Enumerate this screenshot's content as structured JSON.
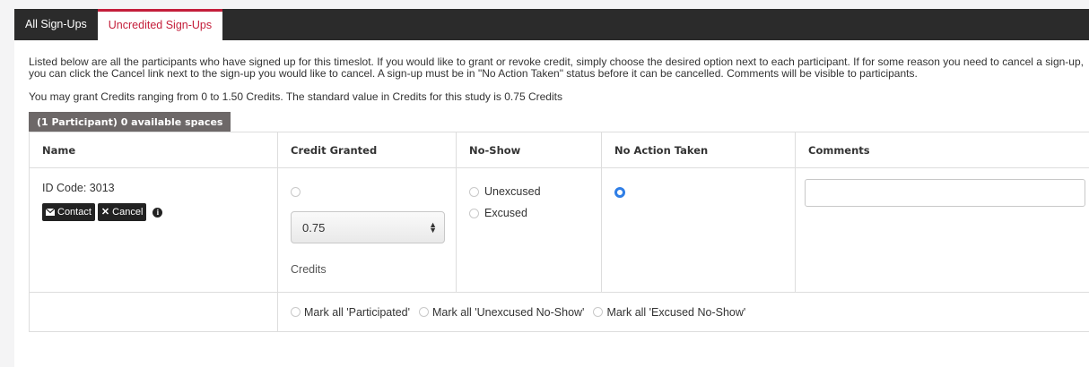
{
  "tabs": [
    {
      "label": "All Sign-Ups",
      "active": false
    },
    {
      "label": "Uncredited Sign-Ups",
      "active": true
    }
  ],
  "description": "Listed below are all the participants who have signed up for this timeslot. If you would like to grant or revoke credit, simply choose the desired option next to each participant. If for some reason you need to cancel a sign-up, you can click the Cancel link next to the sign-up you would like to cancel. A sign-up must be in \"No Action Taken\" status before it can be cancelled. Comments will be visible to participants.",
  "credit_range_text": "You may grant Credits ranging from 0 to 1.50 Credits. The standard value in Credits for this study is 0.75 Credits",
  "spaces_badge": "(1 Participant) 0 available spaces",
  "table": {
    "headers": {
      "name": "Name",
      "credit": "Credit Granted",
      "noshow": "No-Show",
      "noaction": "No Action Taken",
      "comments": "Comments"
    },
    "row": {
      "id_code": "ID Code: 3013",
      "contact_label": "Contact",
      "cancel_label": "Cancel",
      "credit_value": "0.75",
      "credits_label": "Credits",
      "unexcused_label": "Unexcused",
      "excused_label": "Excused",
      "selected_status": "No Action Taken",
      "comment_value": ""
    },
    "footer": {
      "mark_participated": "Mark all 'Participated'",
      "mark_unexcused": "Mark all 'Unexcused No-Show'",
      "mark_excused": "Mark all 'Excused No-Show'"
    }
  },
  "colors": {
    "accent": "#c41e3a",
    "tabbar": "#2b2b2b",
    "radio_selected": "#2f7ee6",
    "badge": "#6d6868"
  },
  "icons": {
    "contact": "envelope-icon",
    "cancel": "x-icon",
    "info": "info-icon",
    "select": "up-down-arrows-icon"
  }
}
